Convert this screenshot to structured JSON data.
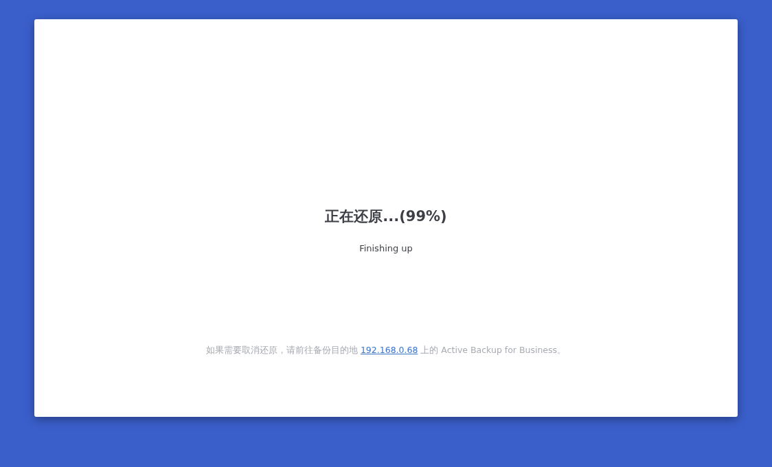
{
  "title": "正在还原...(99%)",
  "subtitle": "Finishing up",
  "note": {
    "before": "如果需要取消还原，请前往备份目的地",
    "link": "192.168.0.68",
    "after": "上的 Active Backup for Business。"
  }
}
